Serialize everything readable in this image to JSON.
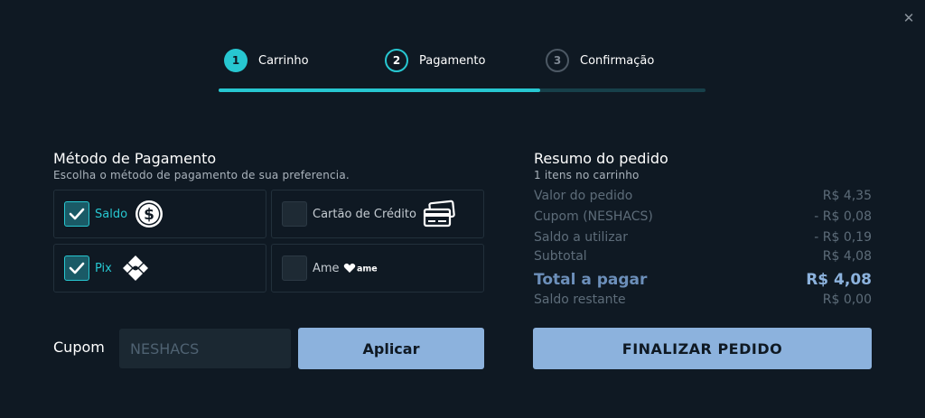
{
  "stepper": {
    "steps": [
      {
        "number": "1",
        "label": "Carrinho",
        "state": "done"
      },
      {
        "number": "2",
        "label": "Pagamento",
        "state": "active"
      },
      {
        "number": "3",
        "label": "Confirmação",
        "state": "pending"
      }
    ],
    "progress_fraction": 0.66
  },
  "payment": {
    "title": "Método de Pagamento",
    "subtitle": "Escolha o método de pagamento de sua preferencia.",
    "methods": [
      {
        "label": "Saldo",
        "checked": true,
        "icon": "dollar-coin-icon"
      },
      {
        "label": "Cartão de Crédito",
        "checked": false,
        "icon": "credit-card-icon"
      },
      {
        "label": "Pix",
        "checked": true,
        "icon": "pix-icon"
      },
      {
        "label": "Ame",
        "checked": false,
        "icon": "ame-logo-icon",
        "logo_text": "ame"
      }
    ]
  },
  "coupon": {
    "label": "Cupom",
    "value": "NESHACS",
    "apply_label": "Aplicar"
  },
  "summary": {
    "title": "Resumo do pedido",
    "items_text": "1 itens no carrinho",
    "rows": [
      {
        "label": "Valor do pedido",
        "value": "R$ 4,35"
      },
      {
        "label": "Cupom (NESHACS)",
        "value": "- R$ 0,08"
      },
      {
        "label": "Saldo a utilizar",
        "value": "- R$ 0,19"
      },
      {
        "label": "Subtotal",
        "value": "R$ 4,08"
      }
    ],
    "total": {
      "label": "Total a pagar",
      "value": "R$ 4,08"
    },
    "remaining": {
      "label": "Saldo restante",
      "value": "R$ 0,00"
    },
    "finalize_label": "FINALIZAR PEDIDO"
  },
  "colors": {
    "background": "#0f1923",
    "accent": "#27c7d1",
    "button": "#8cb2dd"
  }
}
